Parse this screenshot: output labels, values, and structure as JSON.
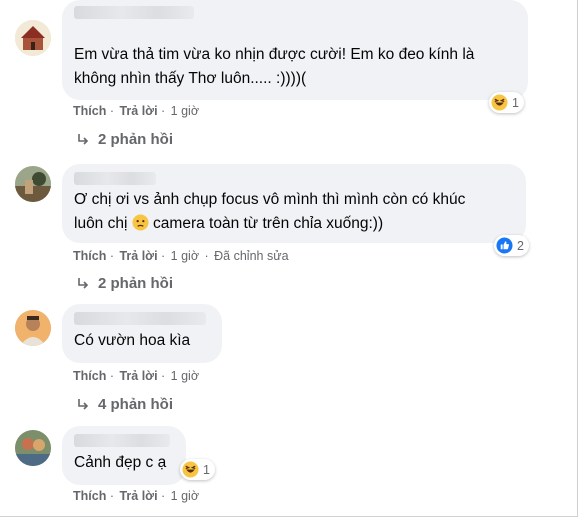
{
  "comments": [
    {
      "text": "Em vừa thả tim vừa ko nhịn được cười! Em ko đeo kính là\nkhông nhìn thấy Thơ luôn..... :))))(",
      "like": "Thích",
      "reply": "Trả lời",
      "time": "1 giờ",
      "reaction_count": "1",
      "reaction_icon": "haha-icon",
      "replies": "2 phản hồi"
    },
    {
      "text_part1": "Ơ chị ơi vs ảnh chụp focus vô mình thì mình còn có khúc\nluôn chị ",
      "text_part2": " camera toàn từ trên chỉa xuống:))",
      "like": "Thích",
      "reply": "Trả lời",
      "time": "1 giờ",
      "edited": "Đã chỉnh sửa",
      "reaction_count": "2",
      "reaction_icon": "like-icon",
      "replies": "2 phản hồi"
    },
    {
      "text": "Có vườn hoa kìa",
      "like": "Thích",
      "reply": "Trả lời",
      "time": "1 giờ",
      "replies": "4 phản hồi"
    },
    {
      "text": "Cảnh đẹp c ạ",
      "like": "Thích",
      "reply": "Trả lời",
      "time": "1 giờ",
      "reaction_count": "1",
      "reaction_icon": "haha-icon"
    }
  ],
  "colors": {
    "bubble": "#f0f2f5",
    "meta": "#65676b",
    "like_blue": "#1877f2",
    "haha_yellow": "#f7c542"
  }
}
